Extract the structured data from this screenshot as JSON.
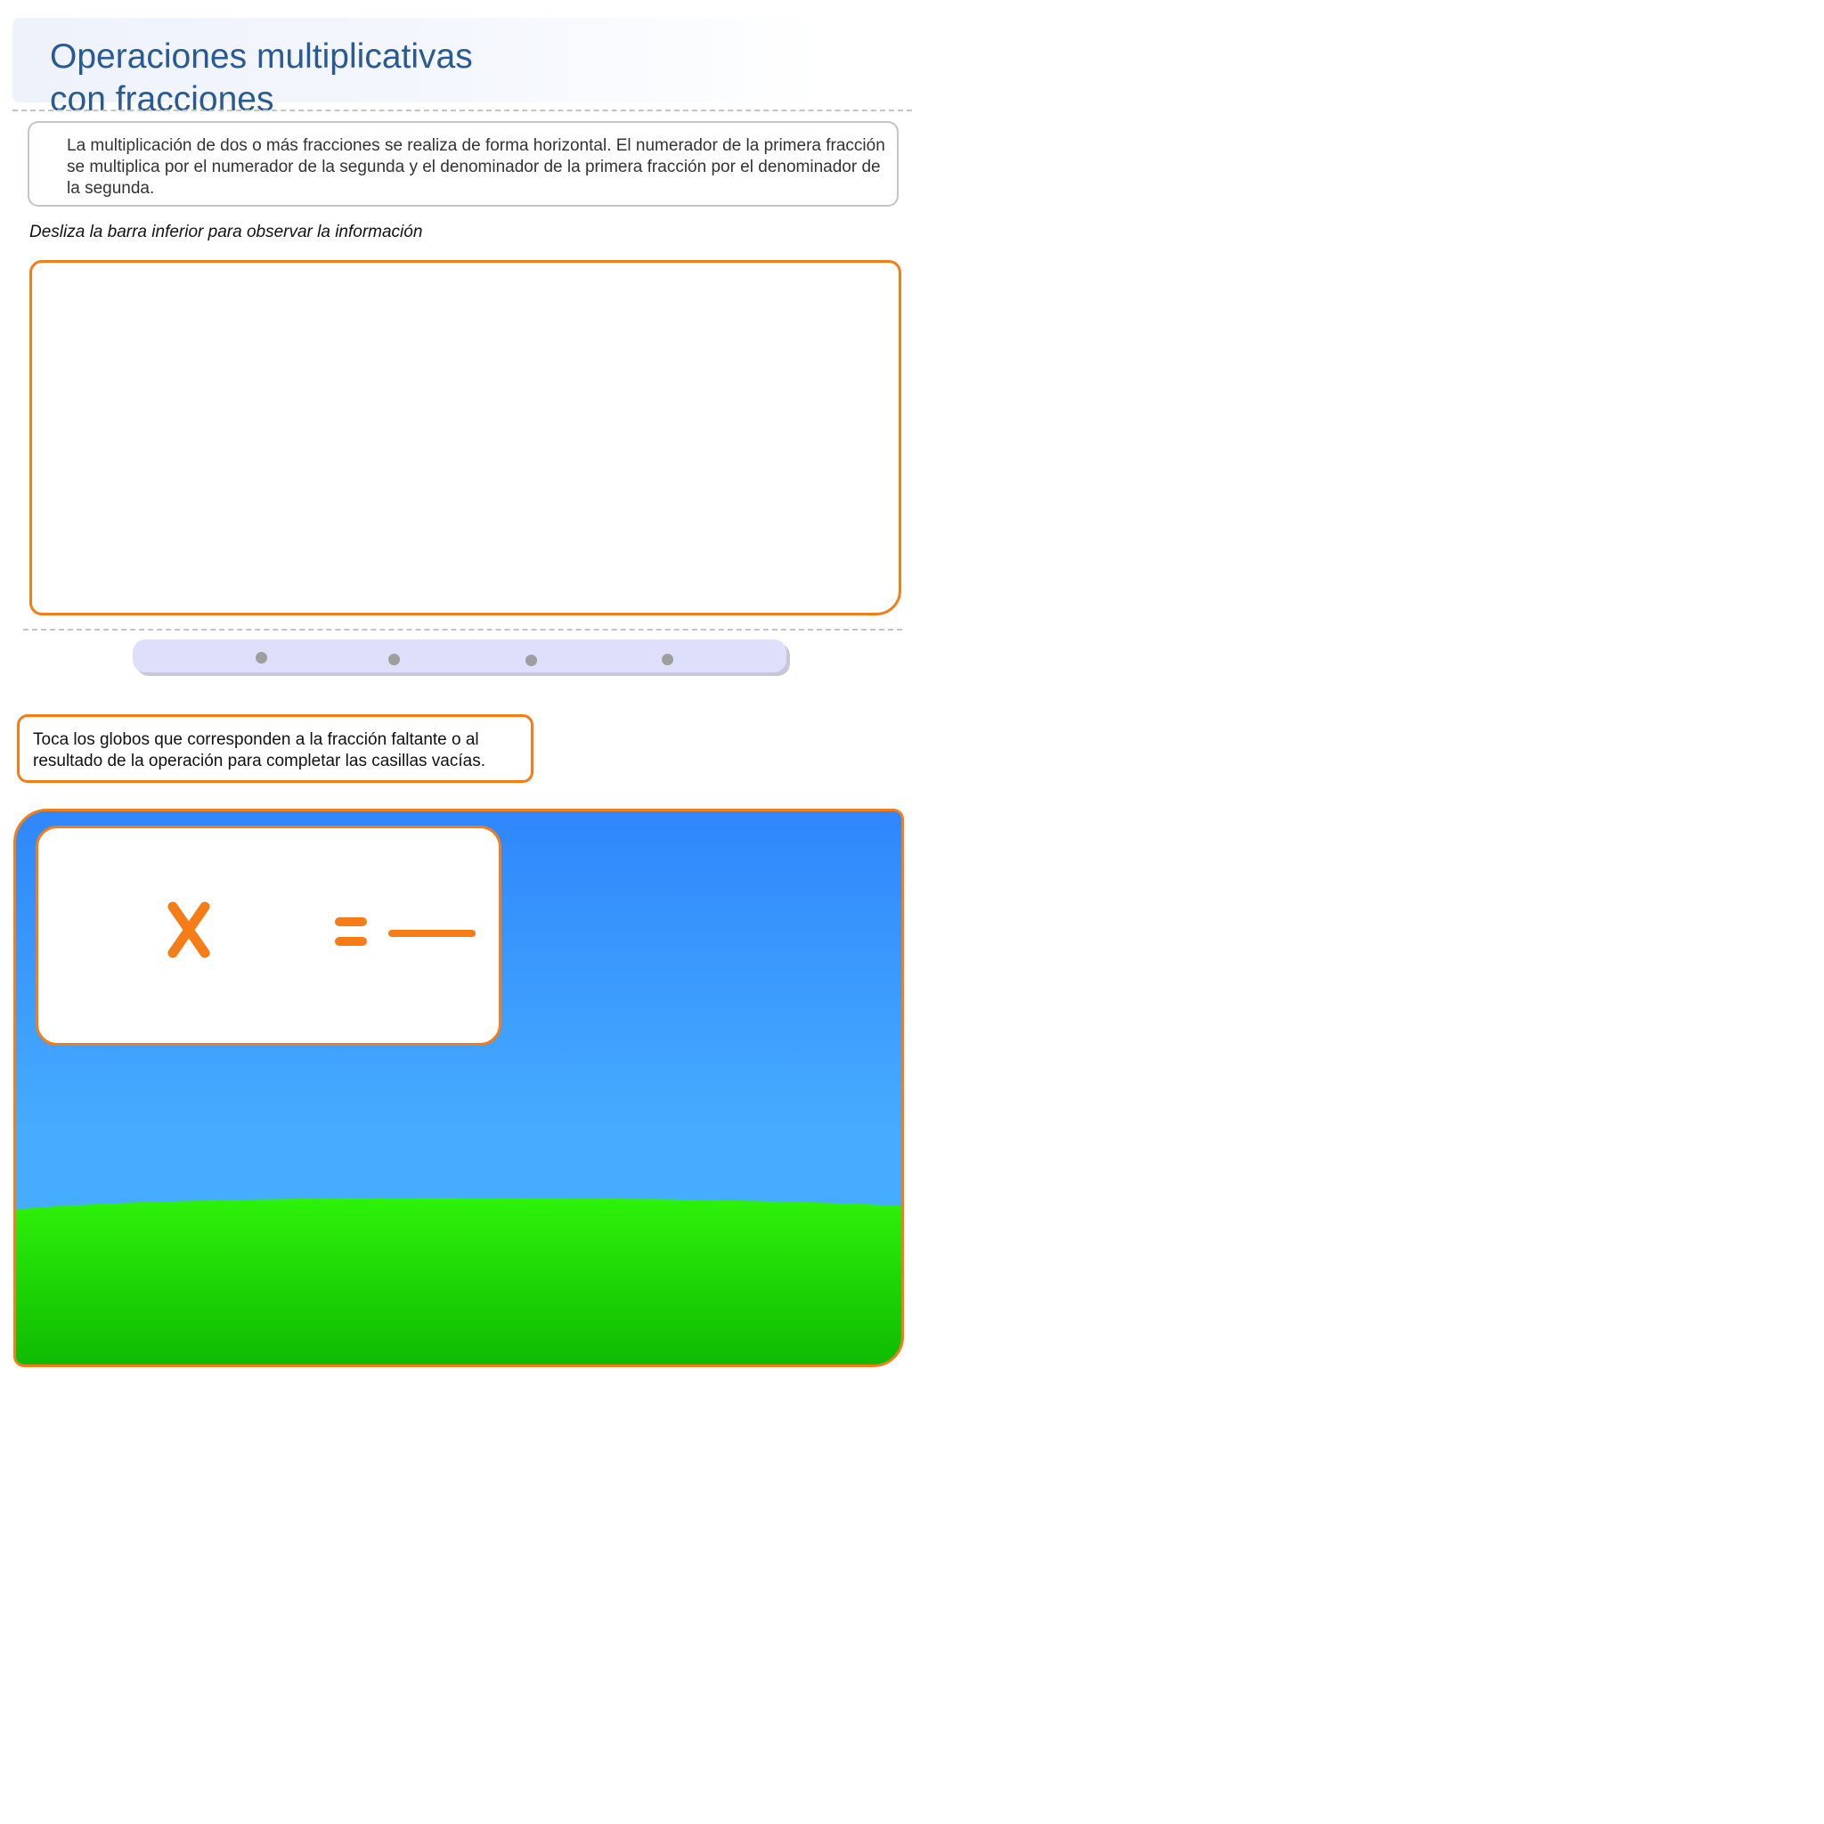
{
  "header": {
    "title": "Operaciones multiplicativas\ncon fracciones"
  },
  "intro": {
    "text": "La multiplicación de dos o más fracciones se realiza de forma horizontal. El numerador de la primera fracción se multiplica por el numerador de la segunda y el denominador de la primera fracción por el denominador de la segunda."
  },
  "hint": {
    "text": "Desliza la barra inferior para observar la información"
  },
  "slider": {
    "steps": 4,
    "current_step": 1
  },
  "instructions": {
    "text": "Toca los globos que corresponden a la fracción faltante o al resultado de la operación para completar las casillas vacías."
  },
  "game": {
    "operator_icon": "times-sign-icon",
    "equals_icon": "equals-sign-icon"
  },
  "colors": {
    "accent": "#f57c16",
    "title": "#2b5a93",
    "sky_top": "#2f87fc",
    "sky_bottom": "#46acff",
    "grass_top": "#2ef20a",
    "grass_bottom": "#04a600",
    "slider_track": "#dedffa",
    "slider_dot": "#9e9e9e"
  }
}
